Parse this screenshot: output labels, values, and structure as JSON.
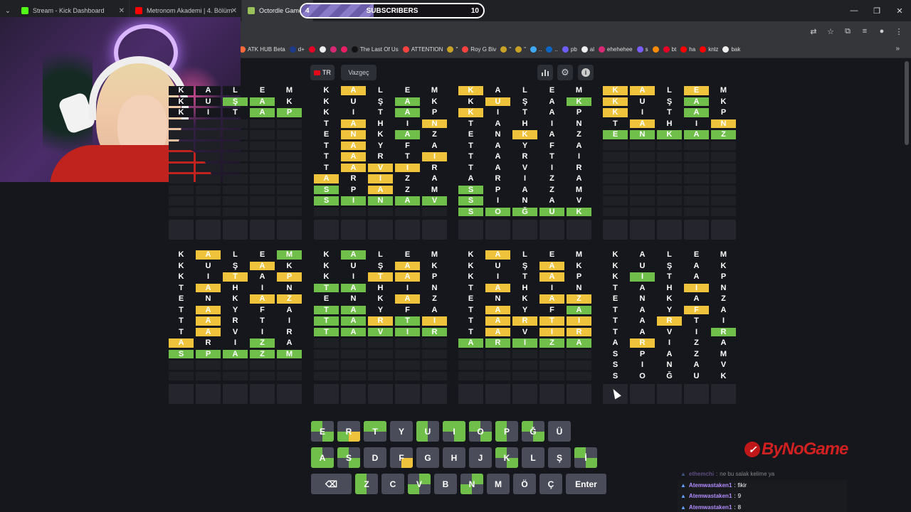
{
  "browser": {
    "tabs": [
      {
        "label": "Stream - Kick Dashboard",
        "color": "#53fc18"
      },
      {
        "label": "Metronom Akademi | 4. Bölüm",
        "color": "#ff0000"
      },
      {
        "label": "Octordle Game",
        "color": "#9ac25a"
      }
    ],
    "window_controls": [
      "—",
      "❐",
      "✕"
    ],
    "toolbar_icons": [
      "translate-icon",
      "star-icon",
      "extension-icon",
      "menu-list-icon",
      "profile-icon",
      "kebab-icon"
    ],
    "bookmarks": [
      {
        "label": "ATK HUB Beta",
        "color": "#ff6a3d"
      },
      {
        "label": "d+",
        "color": "#1e3a8a"
      },
      {
        "label": "",
        "color": "#e60023"
      },
      {
        "label": "",
        "color": "#eee"
      },
      {
        "label": "",
        "color": "#d62976"
      },
      {
        "label": "",
        "color": "#e91e63"
      },
      {
        "label": "The Last Of Us",
        "color": "#111"
      },
      {
        "label": "ATTENTION",
        "color": "#ff4040"
      },
      {
        "label": "\"",
        "color": "#c9a227"
      },
      {
        "label": "Roy G Biv",
        "color": "#ff4040"
      },
      {
        "label": "\"",
        "color": "#c9a227"
      },
      {
        "label": "\"",
        "color": "#c9a227"
      },
      {
        "label": "..",
        "color": "#3fa9f5"
      },
      {
        "label": "..",
        "color": "#0a66c2"
      },
      {
        "label": "pb",
        "color": "#6d5dfc"
      },
      {
        "label": "al",
        "color": "#eee"
      },
      {
        "label": "ehehehee",
        "color": "#d62976"
      },
      {
        "label": "s",
        "color": "#7b5cff"
      },
      {
        "label": "",
        "color": "#ff8c00"
      },
      {
        "label": "bt",
        "color": "#e60023"
      },
      {
        "label": "ha",
        "color": "#ff0000"
      },
      {
        "label": "knlz",
        "color": "#ff0000"
      },
      {
        "label": "bak",
        "color": "#eee"
      }
    ]
  },
  "subscribers": {
    "label": "SUBSCRIBERS",
    "current": "4",
    "goal": "10",
    "progress": 0.4
  },
  "game": {
    "lang_button": "TR",
    "cancel_button": "Vazgeç",
    "icons": [
      "stats-icon",
      "settings-icon",
      "info-icon"
    ],
    "boards": [
      {
        "rows": [
          [
            "K.n",
            "A.n",
            "L.n",
            "E.n",
            "M.n"
          ],
          [
            "K.n",
            "U.n",
            "Ş.g",
            "A.g",
            "K.n"
          ],
          [
            "K.n",
            "I.n",
            "T.n",
            "A.g",
            "P.g"
          ],
          [],
          [],
          [],
          [],
          [],
          [],
          []
        ]
      },
      {
        "rows": [
          [
            "K.n",
            "A.y",
            "L.n",
            "E.n",
            "M.n"
          ],
          [
            "K.n",
            "U.n",
            "Ş.n",
            "A.g",
            "K.n"
          ],
          [
            "K.n",
            "I.n",
            "T.n",
            "A.g",
            "P.n"
          ],
          [
            "T.n",
            "A.y",
            "H.n",
            "I.n",
            "N.y"
          ],
          [
            "E.n",
            "N.y",
            "K.n",
            "A.g",
            "Z.n"
          ],
          [
            "T.n",
            "A.y",
            "Y.n",
            "F.n",
            "A.n"
          ],
          [
            "T.n",
            "A.y",
            "R.n",
            "T.n",
            "I.y"
          ],
          [
            "T.n",
            "A.y",
            "V.y",
            "I.y",
            "R.n"
          ],
          [
            "A.y",
            "R.n",
            "I.y",
            "Z.n",
            "A.n"
          ],
          [
            "S.g",
            "P.n",
            "A.y",
            "Z.n",
            "M.n"
          ],
          [
            "S.g",
            "I.g",
            "N.g",
            "A.g",
            "V.g"
          ]
        ]
      },
      {
        "rows": [
          [
            "K.y",
            "A.n",
            "L.n",
            "E.n",
            "M.n"
          ],
          [
            "K.n",
            "U.y",
            "Ş.n",
            "A.n",
            "K.g"
          ],
          [
            "K.y",
            "I.n",
            "T.n",
            "A.n",
            "P.n"
          ],
          [
            "T.n",
            "A.n",
            "H.n",
            "I.n",
            "N.n"
          ],
          [
            "E.n",
            "N.n",
            "K.y",
            "A.n",
            "Z.n"
          ],
          [
            "T.n",
            "A.n",
            "Y.n",
            "F.n",
            "A.n"
          ],
          [
            "T.n",
            "A.n",
            "R.n",
            "T.n",
            "I.n"
          ],
          [
            "T.n",
            "A.n",
            "V.n",
            "I.n",
            "R.n"
          ],
          [
            "A.n",
            "R.n",
            "I.n",
            "Z.n",
            "A.n"
          ],
          [
            "S.g",
            "P.n",
            "A.n",
            "Z.n",
            "M.n"
          ],
          [
            "S.g",
            "I.n",
            "N.n",
            "A.n",
            "V.n"
          ],
          [
            "S.g",
            "O.g",
            "Ğ.g",
            "U.g",
            "K.g"
          ]
        ]
      },
      {
        "rows": [
          [
            "K.y",
            "A.y",
            "L.n",
            "E.y",
            "M.n"
          ],
          [
            "K.y",
            "U.n",
            "Ş.n",
            "A.g",
            "K.n"
          ],
          [
            "K.y",
            "I.n",
            "T.n",
            "A.g",
            "P.n"
          ],
          [
            "T.n",
            "A.y",
            "H.n",
            "I.n",
            "N.y"
          ],
          [
            "E.g",
            "N.g",
            "K.g",
            "A.g",
            "Z.g"
          ]
        ]
      },
      {
        "rows": [
          [
            "K.n",
            "A.y",
            "L.n",
            "E.n",
            "M.g"
          ],
          [
            "K.n",
            "U.n",
            "Ş.n",
            "A.y",
            "K.n"
          ],
          [
            "K.n",
            "I.n",
            "T.y",
            "A.n",
            "P.y"
          ],
          [
            "T.n",
            "A.y",
            "H.n",
            "I.n",
            "N.n"
          ],
          [
            "E.n",
            "N.n",
            "K.n",
            "A.y",
            "Z.y"
          ],
          [
            "T.n",
            "A.y",
            "Y.n",
            "F.n",
            "A.n"
          ],
          [
            "T.n",
            "A.y",
            "R.n",
            "T.n",
            "I.n"
          ],
          [
            "T.n",
            "A.y",
            "V.n",
            "I.n",
            "R.n"
          ],
          [
            "A.y",
            "R.n",
            "I.n",
            "Z.g",
            "A.n"
          ],
          [
            "S.g",
            "P.g",
            "A.g",
            "Z.g",
            "M.g"
          ]
        ]
      },
      {
        "rows": [
          [
            "K.n",
            "A.g",
            "L.n",
            "E.n",
            "M.n"
          ],
          [
            "K.n",
            "U.n",
            "Ş.n",
            "A.y",
            "K.n"
          ],
          [
            "K.n",
            "I.n",
            "T.y",
            "A.y",
            "P.n"
          ],
          [
            "T.g",
            "A.g",
            "H.n",
            "I.n",
            "N.n"
          ],
          [
            "E.n",
            "N.n",
            "K.n",
            "A.y",
            "Z.n"
          ],
          [
            "T.g",
            "A.g",
            "Y.n",
            "F.n",
            "A.n"
          ],
          [
            "T.g",
            "A.g",
            "R.y",
            "T.g",
            "I.y"
          ],
          [
            "T.g",
            "A.g",
            "V.g",
            "I.g",
            "R.g"
          ]
        ]
      },
      {
        "rows": [
          [
            "K.n",
            "A.y",
            "L.n",
            "E.n",
            "M.n"
          ],
          [
            "K.n",
            "U.n",
            "Ş.n",
            "A.y",
            "K.n"
          ],
          [
            "K.n",
            "I.n",
            "T.n",
            "A.y",
            "P.n"
          ],
          [
            "T.n",
            "A.y",
            "H.n",
            "I.n",
            "N.n"
          ],
          [
            "E.n",
            "N.n",
            "K.n",
            "A.y",
            "Z.y"
          ],
          [
            "T.n",
            "A.y",
            "Y.n",
            "F.n",
            "A.g"
          ],
          [
            "T.n",
            "A.y",
            "R.y",
            "T.y",
            "I.y"
          ],
          [
            "T.n",
            "A.y",
            "V.n",
            "I.y",
            "R.y"
          ],
          [
            "A.g",
            "R.g",
            "I.g",
            "Z.g",
            "A.g"
          ]
        ]
      },
      {
        "rows": [
          [
            "K.n",
            "A.n",
            "L.n",
            "E.n",
            "M.n"
          ],
          [
            "K.n",
            "U.n",
            "Ş.n",
            "A.n",
            "K.n"
          ],
          [
            "K.n",
            "I.g",
            "T.n",
            "A.n",
            "P.n"
          ],
          [
            "T.n",
            "A.n",
            "H.n",
            "I.y",
            "N.n"
          ],
          [
            "E.n",
            "N.n",
            "K.n",
            "A.n",
            "Z.n"
          ],
          [
            "T.n",
            "A.n",
            "Y.n",
            "F.y",
            "A.n"
          ],
          [
            "T.n",
            "A.n",
            "R.y",
            "T.n",
            "I.n"
          ],
          [
            "T.n",
            "A.n",
            "V.n",
            "I.n",
            "R.g"
          ],
          [
            "A.n",
            "R.y",
            "I.n",
            "Z.n",
            "A.n"
          ],
          [
            "S.n",
            "P.n",
            "A.n",
            "Z.n",
            "M.n"
          ],
          [
            "S.n",
            "I.n",
            "N.n",
            "A.n",
            "V.n"
          ],
          [
            "S.n",
            "O.n",
            "Ğ.n",
            "U.n",
            "K.n"
          ]
        ]
      }
    ],
    "keyboard": [
      [
        "E",
        "R",
        "T",
        "Y",
        "U",
        "I",
        "O",
        "P",
        "Ğ",
        "Ü"
      ],
      [
        "A",
        "S",
        "D",
        "F",
        "G",
        "H",
        "J",
        "K",
        "L",
        "Ş",
        "İ"
      ],
      [
        "⌫",
        "Z",
        "C",
        "V",
        "B",
        "N",
        "M",
        "Ö",
        "Ç",
        "Enter"
      ]
    ]
  },
  "overlay": {
    "logo": "ByNoGame",
    "chat": [
      {
        "user": "ethemchi",
        "text": "ne bu salak kelime ya",
        "faded": true
      },
      {
        "user": "Atemwastaken1",
        "text": "fikir",
        "faded": false
      },
      {
        "user": "Atemwastaken1",
        "text": "9",
        "faded": false
      },
      {
        "user": "Atemwastaken1",
        "text": "8",
        "faded": false
      }
    ]
  },
  "colors": {
    "green": "#6fbf4a",
    "yellow": "#f0c33c",
    "empty": "#1f2026",
    "bg": "#16171c"
  }
}
